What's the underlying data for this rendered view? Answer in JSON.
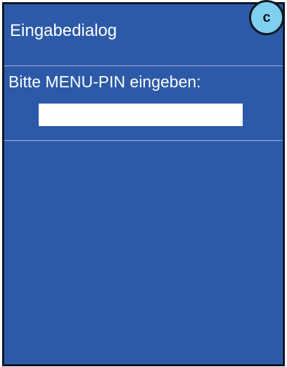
{
  "dialog": {
    "title": "Eingabedialog",
    "prompt": "Bitte MENU-PIN eingeben:",
    "pin_value": ""
  },
  "badge": {
    "label": "c"
  },
  "colors": {
    "screen_background": "#2c5aa8",
    "text": "#ffffff",
    "input_background": "#ffffff",
    "divider": "#9fb6da",
    "badge_background": "#7fcff0",
    "frame": "#101820"
  }
}
